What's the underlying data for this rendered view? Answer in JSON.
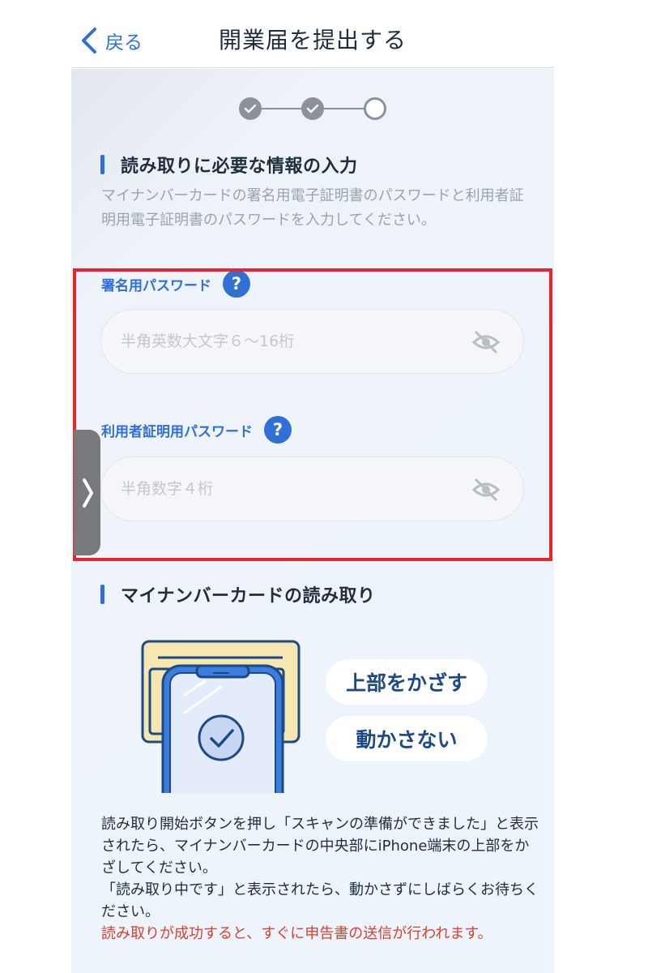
{
  "header": {
    "back_label": "戻る",
    "title": "開業届を提出する"
  },
  "stepper": {
    "steps": [
      "done",
      "done",
      "current"
    ]
  },
  "section_info": {
    "title": "読み取りに必要な情報の入力",
    "description": "マイナンバーカードの署名用電子証明書のパスワードと利用者証明用電子証明書のパスワードを入力してください。"
  },
  "fields": {
    "signature_password": {
      "label": "署名用パスワード",
      "placeholder": "半角英数大文字６〜16桁",
      "value": ""
    },
    "user_password": {
      "label": "利用者証明用パスワード",
      "placeholder": "半角数字４桁",
      "value": ""
    },
    "help_glyph": "?"
  },
  "section_card": {
    "title": "マイナンバーカードの読み取り",
    "pill_top": "上部をかざす",
    "pill_still": "動かさない",
    "instructions": [
      "読み取り開始ボタンを押し「スキャンの準備ができました」と表示されたら、マイナンバーカードの中央部にiPhone端末の上部をかざしてください。",
      "「読み取り中です」と表示されたら、動かさずにしばらくお待ちください。"
    ],
    "warning": "読み取りが成功すると、すぐに申告書の送信が行われます。"
  },
  "colors": {
    "accent": "#2f6fd6",
    "step_gray": "#8c929a",
    "warning": "#d8402e",
    "highlight": "#e5262e"
  },
  "icons": {
    "back": "chevron-left-icon",
    "step_done": "check-icon",
    "help": "question-icon",
    "visibility": "eye-slash-icon",
    "side_handle": "chevron-right-icon"
  }
}
